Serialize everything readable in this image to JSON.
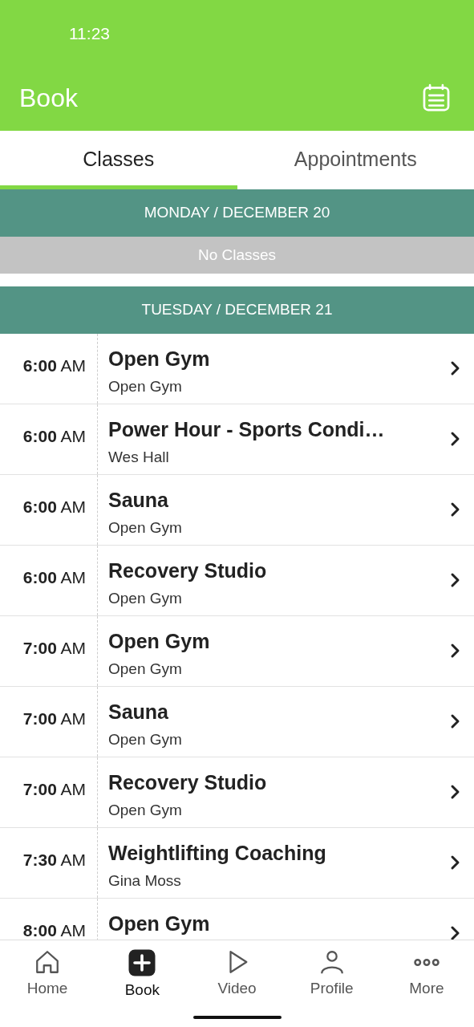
{
  "status_bar": {
    "time": "11:23"
  },
  "header": {
    "title": "Book"
  },
  "tabs": [
    {
      "label": "Classes",
      "selected": true
    },
    {
      "label": "Appointments",
      "selected": false
    }
  ],
  "days": [
    {
      "heading": "MONDAY / DECEMBER 20",
      "empty_text": "No Classes"
    },
    {
      "heading": "TUESDAY / DECEMBER 21",
      "classes": [
        {
          "time": "**6:00** AM",
          "title": "Open Gym",
          "subtitle": "Open Gym"
        },
        {
          "time": "**6:00** AM",
          "title": "Power Hour - Sports Condi…",
          "subtitle": "Wes Hall"
        },
        {
          "time": "**6:00** AM",
          "title": "Sauna",
          "subtitle": "Open Gym"
        },
        {
          "time": "**6:00** AM",
          "title": "Recovery Studio",
          "subtitle": "Open Gym"
        },
        {
          "time": "**7:00** AM",
          "title": "Open Gym",
          "subtitle": "Open Gym"
        },
        {
          "time": "**7:00** AM",
          "title": "Sauna",
          "subtitle": "Open Gym"
        },
        {
          "time": "**7:00** AM",
          "title": "Recovery Studio",
          "subtitle": "Open Gym"
        },
        {
          "time": "**7:30** AM",
          "title": "Weightlifting Coaching",
          "subtitle": "Gina Moss"
        },
        {
          "time": "**8:00** AM",
          "title": "Open Gym"
        }
      ]
    }
  ],
  "nav": [
    {
      "kind": "home",
      "label": "Home",
      "selected": false
    },
    {
      "kind": "book",
      "label": "Book",
      "selected": true
    },
    {
      "kind": "video",
      "label": "Video",
      "selected": false
    },
    {
      "kind": "profile",
      "label": "Profile",
      "selected": false
    },
    {
      "kind": "more",
      "label": "More",
      "selected": false
    }
  ]
}
